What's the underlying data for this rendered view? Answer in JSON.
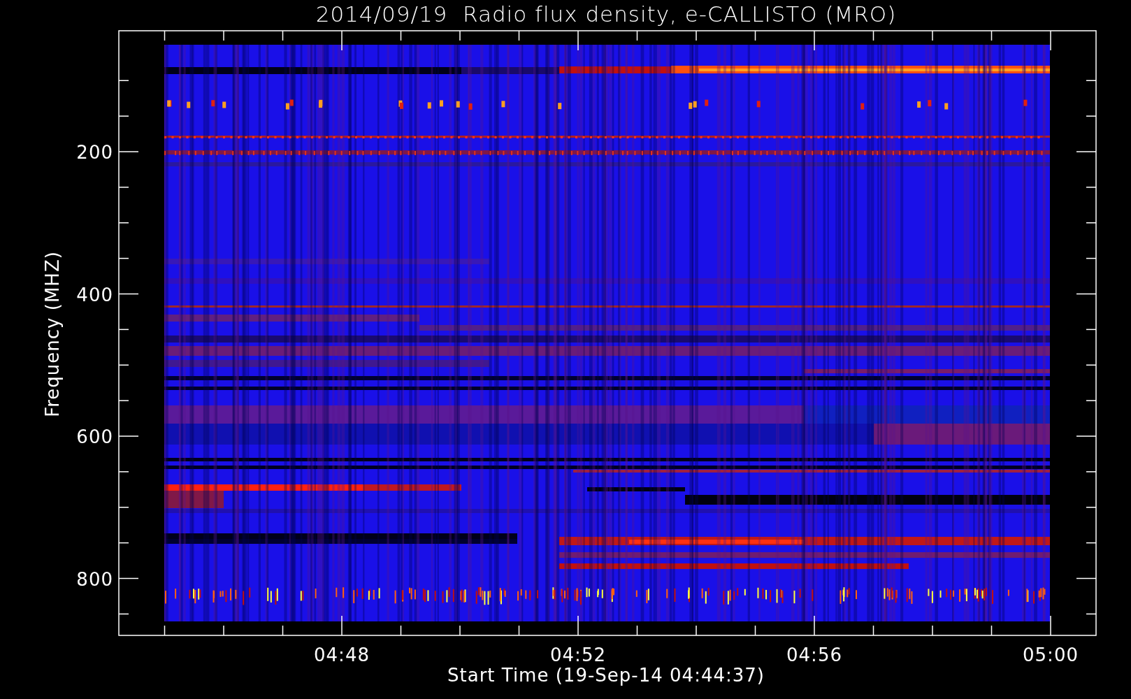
{
  "plot": {
    "title": "2014/09/19  Radio flux density, e-CALLISTO (MRO)",
    "ylabel": "Frequency (MHZ)",
    "xlabel": "Start Time (19-Sep-14 04:44:37)",
    "yticks": [
      "200",
      "400",
      "600",
      "800"
    ],
    "xticks": [
      "04:48",
      "04:52",
      "04:56",
      "05:00"
    ]
  }
}
